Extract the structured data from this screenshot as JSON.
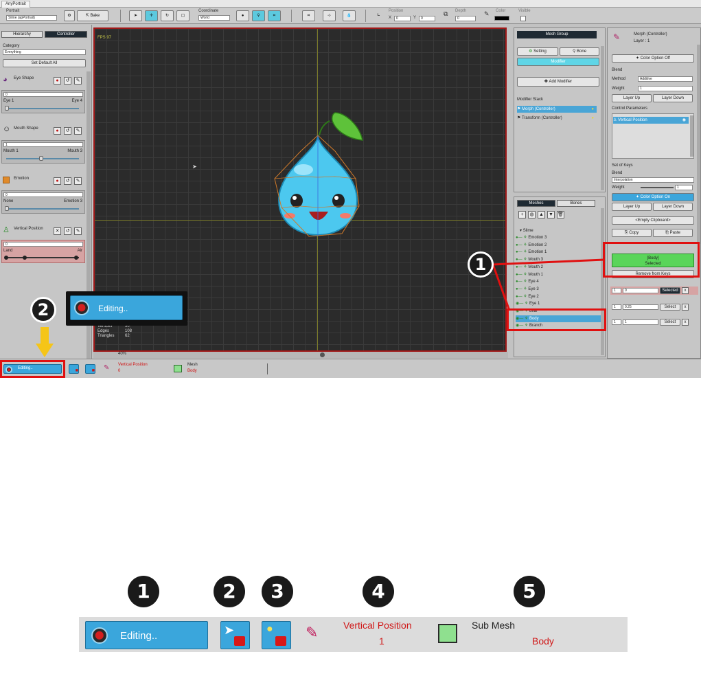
{
  "app": {
    "window_tab": "AnyPortrait",
    "portrait_label": "Portrait",
    "portrait_value": "Slime (apPortrait)",
    "bake_label": "Bake",
    "coordinate_label": "Coordinate",
    "coordinate_value": "World",
    "position_label": "Position",
    "pos_x_label": "X",
    "pos_x": "0",
    "pos_y_label": "Y",
    "pos_y": "0",
    "depth_label": "Depth",
    "depth_value": "0",
    "color_label": "Color",
    "visible_label": "Visible"
  },
  "left": {
    "tab_hierarchy": "Hierarchy",
    "tab_controller": "Controller",
    "category_label": "Category",
    "category_value": "Everything",
    "set_default_all": "Set Default All",
    "controllers": [
      {
        "name": "Eye Shape",
        "value": "0",
        "min": "Eye 1",
        "max": "Eye 4"
      },
      {
        "name": "Mouth Shape",
        "value": "1",
        "min": "Mouth 1",
        "max": "Mouth 3"
      },
      {
        "name": "Emotion",
        "value": "0",
        "min": "None",
        "max": "Emotion 3"
      },
      {
        "name": "Vertical Position",
        "value": "0",
        "min": "Land",
        "max": "Air"
      }
    ]
  },
  "viewport": {
    "fps": "FPS 97",
    "stats": [
      {
        "label": "Vertices",
        "value": "90"
      },
      {
        "label": "Edges",
        "value": "108"
      },
      {
        "label": "Triangles",
        "value": "62"
      }
    ],
    "zoom": "40%"
  },
  "mid": {
    "mesh_group": "Mesh Group",
    "setting": "Setting",
    "bone": "Bone",
    "modifier": "Modifier",
    "add_modifier": "Add Modifier",
    "modifier_stack": "Modifier Stack",
    "stack": [
      "Morph (Controller)",
      "Transform (Controller)"
    ],
    "tab_meshes": "Meshes",
    "tab_bones": "Bones",
    "root": "Slime",
    "meshes": [
      "Emotion 3",
      "Emotion 2",
      "Emotion 1",
      "Mouth 3",
      "Mouth 2",
      "Mouth 1",
      "Eye 4",
      "Eye 3",
      "Eye 2",
      "Eye 1",
      "Leaf",
      "Body",
      "Branch"
    ]
  },
  "right": {
    "title": "Morph (Controller)",
    "layer": "Layer : 1",
    "color_option_off": "Color Option Off",
    "blend_label": "Blend",
    "method_label": "Method",
    "method_value": "Additive",
    "weight_label": "Weight",
    "weight_value": "1",
    "layer_up": "Layer Up",
    "layer_down": "Layer Down",
    "control_params": "Control Parameters",
    "param": "Vertical Position",
    "set_of_keys": "Set of Keys",
    "blend2": "Blend",
    "interp": "Interpolation",
    "weight2_label": "Weight",
    "weight2": "1",
    "color_option_on": "Color Option On",
    "layer_up2": "Layer Up",
    "layer_down2": "Layer Down",
    "clipboard": "<Empty Clipboard>",
    "copy": "Copy",
    "paste": "Paste",
    "body_selected_1": "[Body]",
    "body_selected_2": "Selected",
    "remove_from_keys": "Remove from Keys",
    "keys": [
      {
        "idx": "1",
        "val": "0",
        "btn": "Selected"
      },
      {
        "idx": "1",
        "val": "0.25",
        "btn": "Select"
      },
      {
        "idx": "1",
        "val": "1",
        "btn": "Select"
      }
    ],
    "key_delete": "x"
  },
  "status": {
    "editing": "Editing..",
    "param_name": "Vertical Position",
    "param_value": "0",
    "mesh_label": "Mesh",
    "mesh_value": "Body"
  },
  "callouts": {
    "one": "1",
    "two": "2",
    "editing_zoom": "Editing.."
  },
  "legend": {
    "n1": "1",
    "n2": "2",
    "n3": "3",
    "n4": "4",
    "n5": "5",
    "editing": "Editing..",
    "param_name": "Vertical Position",
    "param_value": "1",
    "sub_mesh": "Sub Mesh",
    "sub_mesh_value": "Body"
  },
  "colors": {
    "accent_blue": "#3aa6dc",
    "highlight_red": "#e01010",
    "green_selected": "#5ad55a",
    "arrow_yellow": "#f5c518"
  }
}
